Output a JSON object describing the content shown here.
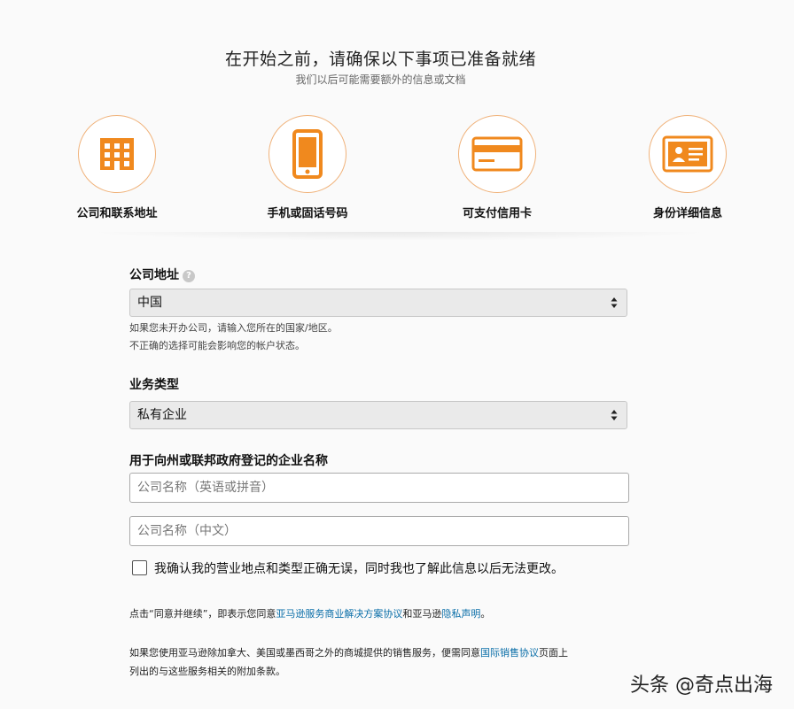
{
  "header": {
    "title": "在开始之前，请确保以下事项已准备就绪",
    "subtitle": "我们以后可能需要额外的信息或文档"
  },
  "prerequisites": [
    {
      "icon": "building-icon",
      "label": "公司和联系地址"
    },
    {
      "icon": "mobile-phone-icon",
      "label": "手机或固话号码"
    },
    {
      "icon": "credit-card-icon",
      "label": "可支付信用卡"
    },
    {
      "icon": "id-card-icon",
      "label": "身份详细信息"
    }
  ],
  "form": {
    "company_address": {
      "label": "公司地址",
      "help": "?",
      "value": "中国",
      "note_line1": "如果您未开办公司，请输入您所在的国家/地区。",
      "note_line2": "不正确的选择可能会影响您的帐户状态。"
    },
    "business_type": {
      "label": "业务类型",
      "value": "私有企业"
    },
    "business_name": {
      "label": "用于向州或联邦政府登记的企业名称",
      "english_placeholder": "公司名称（英语或拼音）",
      "chinese_placeholder": "公司名称（中文）"
    },
    "confirm_checkbox": {
      "label": "我确认我的营业地点和类型正确无误，同时我也了解此信息以后无法更改。",
      "checked": false
    }
  },
  "legal": {
    "p1_prefix": "点击“同意并继续”，即表示您同意",
    "p1_link1": "亚马逊服务商业解决方案协议",
    "p1_mid": "和亚马逊",
    "p1_link2": "隐私声明",
    "p1_suffix": "。",
    "p2_prefix": "如果您使用亚马逊除加拿大、美国或墨西哥之外的商城提供的销售服务，便需同意",
    "p2_link": "国际销售协议",
    "p2_suffix_line1": "页面上",
    "p2_line2": "列出的与这些服务相关的附加条款。"
  },
  "watermark": {
    "text": "头条 @奇点出海"
  },
  "colors": {
    "accent": "#f0891e",
    "link": "#0a6ea8"
  }
}
